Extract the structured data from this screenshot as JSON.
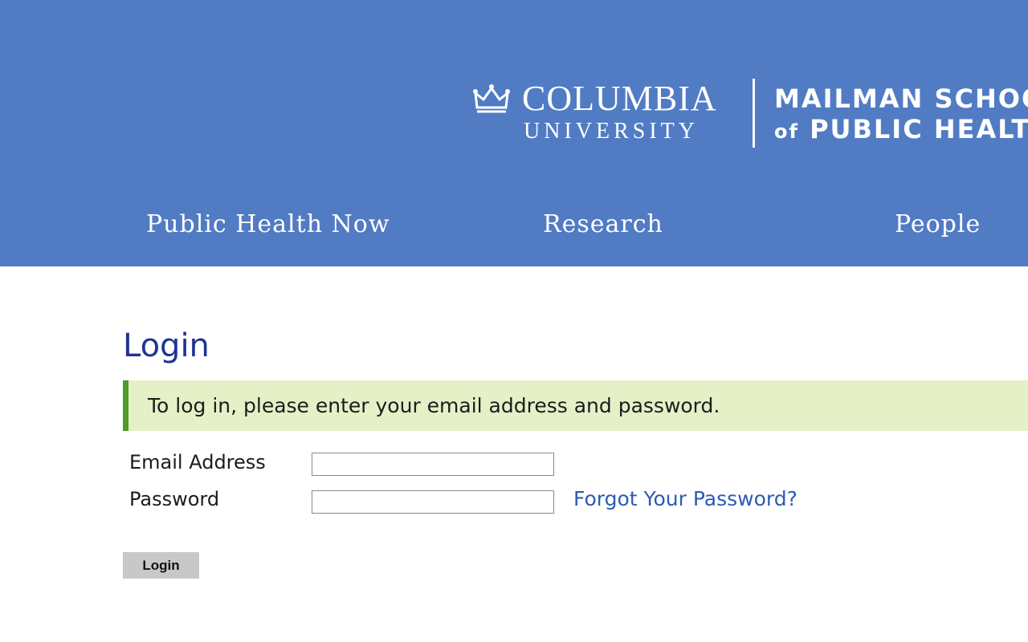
{
  "colors": {
    "header_bg": "#517cc4",
    "title": "#1f3591",
    "notice_bg": "#e5f0c7",
    "notice_border": "#4f9a2c",
    "link": "#2e5bb5",
    "button_bg": "#c8c8c8"
  },
  "header": {
    "logo": {
      "icon": "crown-icon",
      "columbia_line1": "COLUMBIA",
      "columbia_line2": "UNIVERSITY",
      "school_line1": "MAILMAN SCHOOL",
      "school_of": "of",
      "school_line2": "PUBLIC HEALTH"
    },
    "nav": [
      {
        "label": "Public Health Now"
      },
      {
        "label": "Research"
      },
      {
        "label": "People"
      }
    ]
  },
  "main": {
    "title": "Login",
    "notice": "To log in, please enter your email address and password.",
    "email_label": "Email Address",
    "email_value": "",
    "password_label": "Password",
    "password_value": "",
    "forgot_link": "Forgot Your Password?",
    "login_button": "Login"
  }
}
